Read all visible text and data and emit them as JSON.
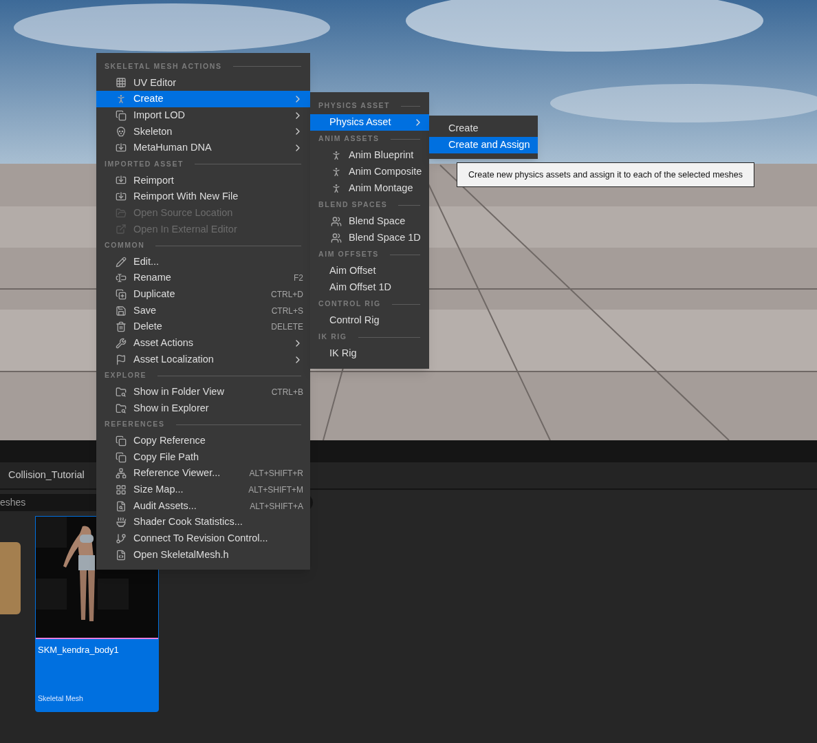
{
  "content_browser": {
    "tab": "Collision_Tutorial",
    "search": {
      "value": "eshes"
    },
    "assets": [
      {
        "kind": "folder"
      },
      {
        "kind": "asset",
        "name": "SKM_kendra_body1",
        "type": "Skeletal Mesh",
        "selected": true
      }
    ]
  },
  "context_menu": {
    "items": [
      {
        "kind": "header",
        "label": "SKELETAL MESH ACTIONS"
      },
      {
        "kind": "item",
        "label": "UV Editor",
        "submenu": false,
        "disabled": false,
        "selected": false
      },
      {
        "kind": "item",
        "label": "Create",
        "submenu": true,
        "disabled": false,
        "selected": true
      },
      {
        "kind": "item",
        "label": "Import LOD",
        "submenu": true,
        "disabled": false,
        "selected": false
      },
      {
        "kind": "item",
        "label": "Skeleton",
        "submenu": true,
        "disabled": false,
        "selected": false
      },
      {
        "kind": "item",
        "label": "MetaHuman DNA",
        "submenu": true,
        "disabled": false,
        "selected": false
      },
      {
        "kind": "header",
        "label": "IMPORTED ASSET"
      },
      {
        "kind": "item",
        "label": "Reimport",
        "submenu": false,
        "disabled": false,
        "selected": false
      },
      {
        "kind": "item",
        "label": "Reimport With New File",
        "submenu": false,
        "disabled": false,
        "selected": false
      },
      {
        "kind": "item",
        "label": "Open Source Location",
        "submenu": false,
        "disabled": true,
        "selected": false
      },
      {
        "kind": "item",
        "label": "Open In External Editor",
        "submenu": false,
        "disabled": true,
        "selected": false
      },
      {
        "kind": "header",
        "label": "COMMON"
      },
      {
        "kind": "item",
        "label": "Edit...",
        "submenu": false,
        "disabled": false,
        "selected": false
      },
      {
        "kind": "item",
        "label": "Rename",
        "shortcut": "F2",
        "submenu": false,
        "disabled": false,
        "selected": false
      },
      {
        "kind": "item",
        "label": "Duplicate",
        "shortcut": "CTRL+D",
        "submenu": false,
        "disabled": false,
        "selected": false
      },
      {
        "kind": "item",
        "label": "Save",
        "shortcut": "CTRL+S",
        "submenu": false,
        "disabled": false,
        "selected": false
      },
      {
        "kind": "item",
        "label": "Delete",
        "shortcut": "DELETE",
        "submenu": false,
        "disabled": false,
        "selected": false
      },
      {
        "kind": "item",
        "label": "Asset Actions",
        "submenu": true,
        "disabled": false,
        "selected": false
      },
      {
        "kind": "item",
        "label": "Asset Localization",
        "submenu": true,
        "disabled": false,
        "selected": false
      },
      {
        "kind": "header",
        "label": "EXPLORE"
      },
      {
        "kind": "item",
        "label": "Show in Folder View",
        "shortcut": "CTRL+B",
        "submenu": false,
        "disabled": false,
        "selected": false
      },
      {
        "kind": "item",
        "label": "Show in Explorer",
        "submenu": false,
        "disabled": false,
        "selected": false
      },
      {
        "kind": "header",
        "label": "REFERENCES"
      },
      {
        "kind": "item",
        "label": "Copy Reference",
        "submenu": false,
        "disabled": false,
        "selected": false
      },
      {
        "kind": "item",
        "label": "Copy File Path",
        "submenu": false,
        "disabled": false,
        "selected": false
      },
      {
        "kind": "item",
        "label": "Reference Viewer...",
        "shortcut": "ALT+SHIFT+R",
        "submenu": false,
        "disabled": false,
        "selected": false
      },
      {
        "kind": "item",
        "label": "Size Map...",
        "shortcut": "ALT+SHIFT+M",
        "submenu": false,
        "disabled": false,
        "selected": false
      },
      {
        "kind": "item",
        "label": "Audit Assets...",
        "shortcut": "ALT+SHIFT+A",
        "submenu": false,
        "disabled": false,
        "selected": false
      },
      {
        "kind": "item",
        "label": "Shader Cook Statistics...",
        "submenu": false,
        "disabled": false,
        "selected": false
      },
      {
        "kind": "item",
        "label": "Connect To Revision Control...",
        "submenu": false,
        "disabled": false,
        "selected": false
      },
      {
        "kind": "item",
        "label": "Open SkeletalMesh.h",
        "submenu": false,
        "disabled": false,
        "selected": false
      }
    ]
  },
  "create_submenu": {
    "items": [
      {
        "kind": "header",
        "label": "PHYSICS ASSET"
      },
      {
        "kind": "item",
        "label": "Physics Asset",
        "submenu": true,
        "selected": true
      },
      {
        "kind": "header",
        "label": "ANIM ASSETS"
      },
      {
        "kind": "item",
        "label": "Anim Blueprint",
        "submenu": false,
        "selected": false
      },
      {
        "kind": "item",
        "label": "Anim Composite",
        "submenu": false,
        "selected": false
      },
      {
        "kind": "item",
        "label": "Anim Montage",
        "submenu": false,
        "selected": false
      },
      {
        "kind": "header",
        "label": "BLEND SPACES"
      },
      {
        "kind": "item",
        "label": "Blend Space",
        "submenu": false,
        "selected": false
      },
      {
        "kind": "item",
        "label": "Blend Space 1D",
        "submenu": false,
        "selected": false
      },
      {
        "kind": "header",
        "label": "AIM OFFSETS"
      },
      {
        "kind": "item",
        "label": "Aim Offset",
        "submenu": false,
        "selected": false
      },
      {
        "kind": "item",
        "label": "Aim Offset 1D",
        "submenu": false,
        "selected": false
      },
      {
        "kind": "header",
        "label": "CONTROL RIG"
      },
      {
        "kind": "item",
        "label": "Control Rig",
        "submenu": false,
        "selected": false
      },
      {
        "kind": "header",
        "label": "IK RIG"
      },
      {
        "kind": "item",
        "label": "IK Rig",
        "submenu": false,
        "selected": false
      }
    ]
  },
  "physics_submenu": {
    "items": [
      {
        "label": "Create",
        "selected": false
      },
      {
        "label": "Create and Assign",
        "selected": true
      }
    ]
  },
  "tooltip": {
    "text": "Create new physics assets and assign it to each of the selected meshes"
  }
}
